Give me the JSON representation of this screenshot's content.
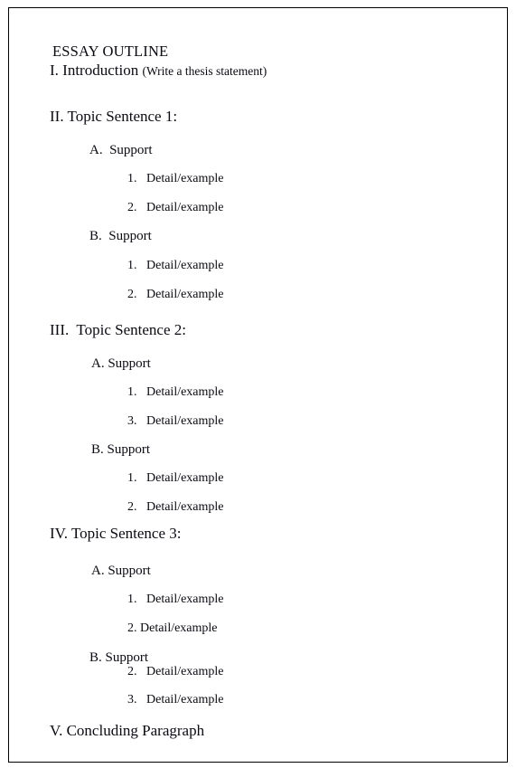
{
  "document": {
    "title": "ESSAY OUTLINE",
    "page_border_color": "#000000",
    "text_color": "#0a0a12",
    "background_color": "#ffffff"
  },
  "outline": {
    "heading": "ESSAY OUTLINE",
    "sections": [
      {
        "marker": "I. Introduction",
        "note": "(Write a thesis statement)",
        "supports": []
      },
      {
        "marker": "II. Topic Sentence 1:",
        "supports": [
          {
            "label": "A.  Support",
            "details": [
              "1.   Detail/example",
              "2.   Detail/example"
            ]
          },
          {
            "label": "B.  Support",
            "details": [
              "1.   Detail/example",
              "2.   Detail/example"
            ]
          }
        ]
      },
      {
        "marker": "III.  Topic Sentence 2:",
        "supports": [
          {
            "label": "A. Support",
            "details": [
              "1.   Detail/example",
              "3.   Detail/example"
            ]
          },
          {
            "label": "B. Support",
            "details": [
              "1.   Detail/example",
              "2.   Detail/example"
            ]
          }
        ]
      },
      {
        "marker": "IV. Topic Sentence 3:",
        "supports": [
          {
            "label": "A. Support",
            "details": [
              "1.   Detail/example",
              "2. Detail/example"
            ]
          },
          {
            "label": "B. Support",
            "details": [
              "2.   Detail/example",
              "3.   Detail/example"
            ]
          }
        ]
      },
      {
        "marker": "V. Concluding Paragraph",
        "supports": []
      }
    ]
  },
  "lines": {
    "l01_title": "ESSAY OUTLINE",
    "l02_intro": "I. Introduction ",
    "l02_intro_note": "(Write a thesis statement)",
    "l03_topic1": "II. Topic Sentence 1:",
    "l04_a": "A.  Support",
    "l05_a1": "1.   Detail/example",
    "l06_a2": "2.   Detail/example",
    "l07_b": "B.  Support",
    "l08_b1": "1.   Detail/example",
    "l09_b2": "2.   Detail/example",
    "l10_topic2": "III.  Topic Sentence 2:",
    "l11_a": "A. Support",
    "l12_a1": "1.   Detail/example",
    "l13_a3": "3.   Detail/example",
    "l14_b": "B. Support",
    "l15_b1": "1.   Detail/example",
    "l16_b2": "2.   Detail/example",
    "l17_topic3": "IV. Topic Sentence 3:",
    "l18_a": "A. Support",
    "l19_a1": "1.   Detail/example",
    "l20_a2": "2. Detail/example",
    "l21_b": "B. Support",
    "l22_b2": "2.   Detail/example",
    "l23_b3": "3.   Detail/example",
    "l24_conclusion": "V. Concluding Paragraph"
  }
}
